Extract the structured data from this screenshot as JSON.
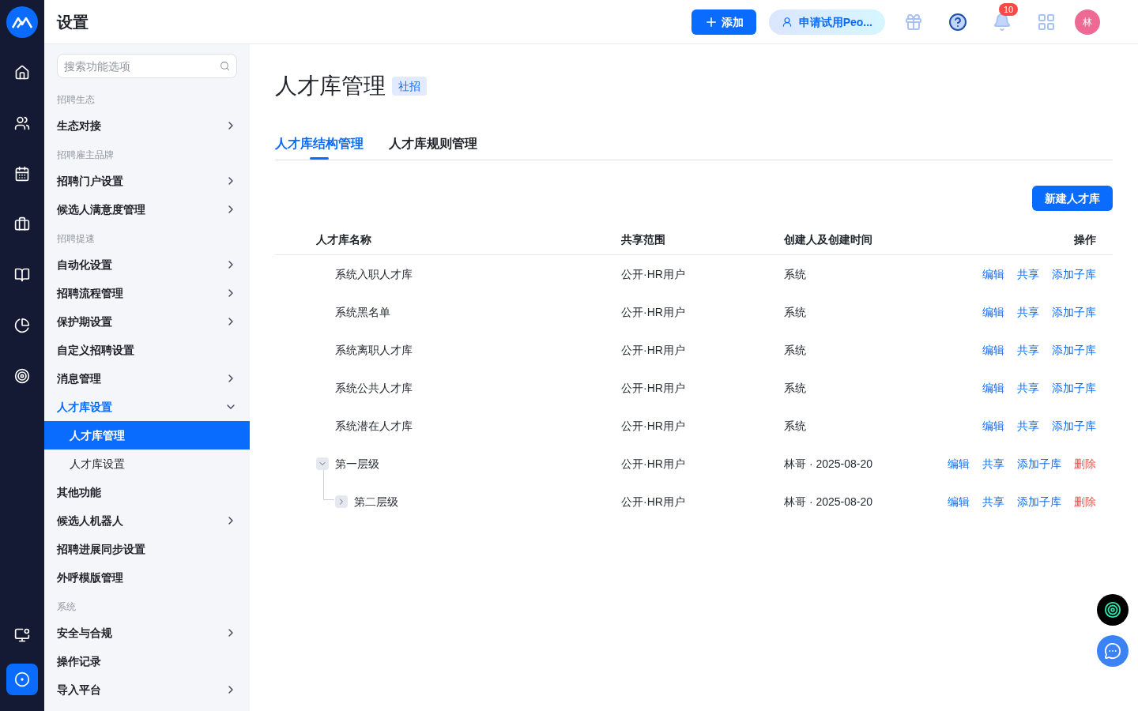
{
  "header": {
    "title": "设置",
    "add_button": "添加",
    "trial_button": "申请试用Peo...",
    "notification_count": "10",
    "avatar": "林"
  },
  "rail": [
    {
      "selected": false
    },
    {
      "selected": false
    },
    {
      "selected": false
    },
    {
      "selected": false
    },
    {
      "selected": false
    },
    {
      "selected": false
    },
    {
      "selected": false
    }
  ],
  "rail_bottom": [
    {
      "selected": false
    },
    {
      "selected": true
    }
  ],
  "sidebar": {
    "search": {
      "placeholder": "搜索功能选项"
    },
    "items": [
      {
        "kind": "group",
        "label": "招聘生态"
      },
      {
        "kind": "item",
        "label": "生态对接",
        "has_children": true,
        "expanded": false,
        "selected": false
      },
      {
        "kind": "group",
        "label": "招聘雇主品牌"
      },
      {
        "kind": "item",
        "label": "招聘门户设置",
        "has_children": true,
        "expanded": false,
        "selected": false
      },
      {
        "kind": "item",
        "label": "候选人满意度管理",
        "has_children": true,
        "expanded": false,
        "selected": false
      },
      {
        "kind": "group",
        "label": "招聘提速"
      },
      {
        "kind": "item",
        "label": "自动化设置",
        "has_children": true,
        "expanded": false,
        "selected": false
      },
      {
        "kind": "item",
        "label": "招聘流程管理",
        "has_children": true,
        "expanded": false,
        "selected": false
      },
      {
        "kind": "item",
        "label": "保护期设置",
        "has_children": true,
        "expanded": false,
        "selected": false
      },
      {
        "kind": "item",
        "label": "自定义招聘设置",
        "has_children": false,
        "selected": false
      },
      {
        "kind": "item",
        "label": "消息管理",
        "has_children": true,
        "expanded": false,
        "selected": false
      },
      {
        "kind": "item",
        "label": "人才库设置",
        "has_children": true,
        "expanded": true,
        "selected": true
      },
      {
        "kind": "sub",
        "label": "人才库管理",
        "selected": true
      },
      {
        "kind": "sub",
        "label": "人才库设置",
        "selected": false
      },
      {
        "kind": "item",
        "label": "其他功能",
        "has_children": false,
        "selected": false
      },
      {
        "kind": "item",
        "label": "候选人机器人",
        "has_children": true,
        "expanded": false,
        "selected": false
      },
      {
        "kind": "item",
        "label": "招聘进展同步设置",
        "has_children": false,
        "selected": false
      },
      {
        "kind": "item",
        "label": "外呼模版管理",
        "has_children": false,
        "selected": false
      },
      {
        "kind": "group",
        "label": "系统"
      },
      {
        "kind": "item",
        "label": "安全与合规",
        "has_children": true,
        "expanded": false,
        "selected": false
      },
      {
        "kind": "item",
        "label": "操作记录",
        "has_children": false,
        "selected": false
      },
      {
        "kind": "item",
        "label": "导入平台",
        "has_children": true,
        "expanded": false,
        "selected": false
      }
    ]
  },
  "page": {
    "title": "人才库管理",
    "tag": "社招",
    "tabs": [
      {
        "label": "人才库结构管理",
        "selected": true
      },
      {
        "label": "人才库规则管理",
        "selected": false
      }
    ],
    "new_button": "新建人才库",
    "table": {
      "columns": [
        "人才库名称",
        "共享范围",
        "创建人及创建时间",
        "操作"
      ],
      "rows": [
        {
          "name": "系统入职人才库",
          "scope": "公开·HR用户",
          "creator": "系统",
          "actions": [
            {
              "label": "编辑",
              "kind": "link"
            },
            {
              "label": "共享",
              "kind": "link"
            },
            {
              "label": "添加子库",
              "kind": "link"
            }
          ]
        },
        {
          "name": "系统黑名单",
          "scope": "公开·HR用户",
          "creator": "系统",
          "actions": [
            {
              "label": "编辑",
              "kind": "link"
            },
            {
              "label": "共享",
              "kind": "link"
            },
            {
              "label": "添加子库",
              "kind": "link"
            }
          ]
        },
        {
          "name": "系统离职人才库",
          "scope": "公开·HR用户",
          "creator": "系统",
          "actions": [
            {
              "label": "编辑",
              "kind": "link"
            },
            {
              "label": "共享",
              "kind": "link"
            },
            {
              "label": "添加子库",
              "kind": "link"
            }
          ]
        },
        {
          "name": "系统公共人才库",
          "scope": "公开·HR用户",
          "creator": "系统",
          "actions": [
            {
              "label": "编辑",
              "kind": "link"
            },
            {
              "label": "共享",
              "kind": "link"
            },
            {
              "label": "添加子库",
              "kind": "link"
            }
          ]
        },
        {
          "name": "系统潜在人才库",
          "scope": "公开·HR用户",
          "creator": "系统",
          "actions": [
            {
              "label": "编辑",
              "kind": "link"
            },
            {
              "label": "共享",
              "kind": "link"
            },
            {
              "label": "添加子库",
              "kind": "link"
            }
          ]
        },
        {
          "name": "第一层级",
          "scope": "公开·HR用户",
          "creator": "林哥 · 2025-08-20",
          "expanded": true,
          "actions": [
            {
              "label": "编辑",
              "kind": "link"
            },
            {
              "label": "共享",
              "kind": "link"
            },
            {
              "label": "添加子库",
              "kind": "link"
            },
            {
              "label": "删除",
              "kind": "danger"
            }
          ],
          "children": [
            {
              "name": "第二层级",
              "scope": "公开·HR用户",
              "creator": "林哥 · 2025-08-20",
              "expanded": false,
              "has_children": true,
              "actions": [
                {
                  "label": "编辑",
                  "kind": "link"
                },
                {
                  "label": "共享",
                  "kind": "link"
                },
                {
                  "label": "添加子库",
                  "kind": "link"
                },
                {
                  "label": "删除",
                  "kind": "danger"
                }
              ]
            }
          ]
        }
      ]
    }
  }
}
